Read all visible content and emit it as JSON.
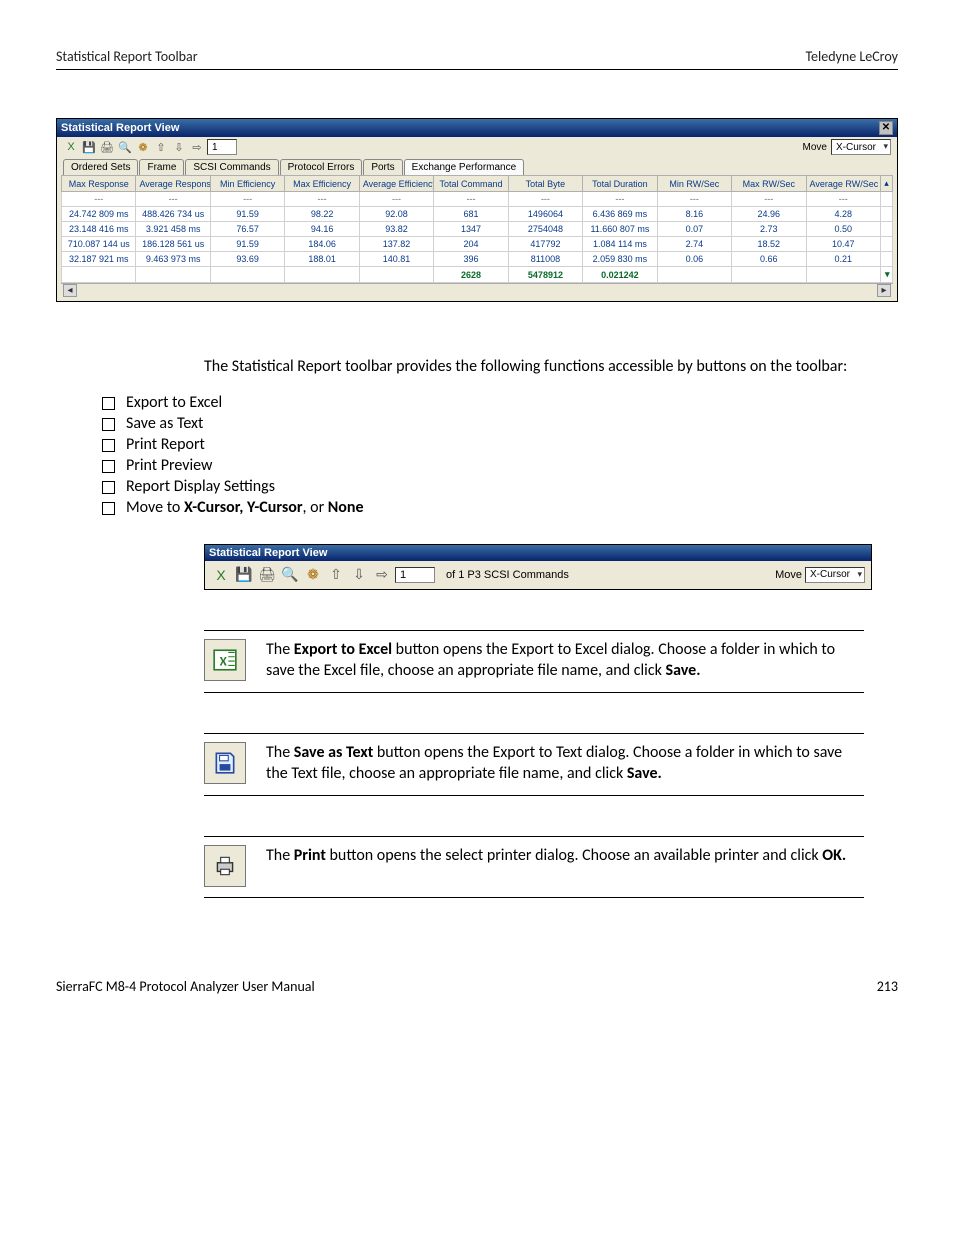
{
  "header": {
    "left": "Statistical Report Toolbar",
    "right": "Teledyne LeCroy"
  },
  "ss1": {
    "title": "Statistical Report View",
    "close": "✕",
    "page_value": "1",
    "move_label": "Move",
    "move_value": "X-Cursor",
    "tabs": [
      "Ordered Sets",
      "Frame",
      "SCSI Commands",
      "Protocol Errors",
      "Ports",
      "Exchange Performance"
    ],
    "active_tab": 5,
    "columns": [
      "Max Response",
      "Average Response",
      "Min Efficiency",
      "Max Efficiency",
      "Average Efficiency",
      "Total Command",
      "Total Byte",
      "Total Duration",
      "Min RW/Sec",
      "Max RW/Sec",
      "Average RW/Sec"
    ],
    "rows": [
      [
        "---",
        "---",
        "---",
        "---",
        "---",
        "---",
        "---",
        "---",
        "---",
        "---",
        "---"
      ],
      [
        "24.742 809  ms",
        "488.426 734  us",
        "91.59",
        "98.22",
        "92.08",
        "681",
        "1496064",
        "6.436 869  ms",
        "8.16",
        "24.96",
        "4.28"
      ],
      [
        "23.148 416  ms",
        "3.921 458  ms",
        "76.57",
        "94.16",
        "93.82",
        "1347",
        "2754048",
        "11.660 807  ms",
        "0.07",
        "2.73",
        "0.50"
      ],
      [
        "710.087 144  us",
        "186.128 561  us",
        "91.59",
        "184.06",
        "137.82",
        "204",
        "417792",
        "1.084 114  ms",
        "2.74",
        "18.52",
        "10.47"
      ],
      [
        "32.187 921  ms",
        "9.463 973  ms",
        "93.69",
        "188.01",
        "140.81",
        "396",
        "811008",
        "2.059 830  ms",
        "0.06",
        "0.66",
        "0.21"
      ]
    ],
    "summary": [
      "",
      "",
      "",
      "",
      "",
      "2628",
      "5478912",
      "0.021242",
      "",
      "",
      ""
    ]
  },
  "intro": "The Statistical Report toolbar provides the following functions accessible by buttons on the toolbar:",
  "checklist": [
    "Export to Excel",
    "Save as Text",
    "Print Report",
    "Print Preview",
    "Report Display Settings"
  ],
  "checklist_move": {
    "prefix": "Move to ",
    "bold": "X-Cursor, Y-Cursor",
    "mid": ", or ",
    "bold2": "None"
  },
  "ss2": {
    "title": "Statistical Report View",
    "page_value": "1",
    "caption": "of 1  P3  SCSI Commands",
    "move_label": "Move",
    "move_value": "X-Cursor"
  },
  "feat1": {
    "pre": "The ",
    "bold": "Export to Excel",
    "post": " button opens the Export to Excel dialog. Choose a folder in which to save the Excel file, choose an appropriate file name, and click ",
    "bold2": "Save."
  },
  "feat2": {
    "pre": "The ",
    "bold": "Save as Text",
    "post": " button opens the Export to Text dialog. Choose a folder in which to save the Text file, choose an appropriate file name, and click ",
    "bold2": "Save."
  },
  "feat3": {
    "pre": "The ",
    "bold": "Print",
    "post": " button opens the select printer dialog. Choose an available printer and click ",
    "bold2": "OK."
  },
  "footer": {
    "left": "SierraFC M8-4 Protocol Analyzer User Manual",
    "right": "213"
  },
  "toolbar_icons": [
    {
      "name": "export-excel-icon",
      "color": "#2a7a2a",
      "glyph": "X"
    },
    {
      "name": "save-text-icon",
      "color": "#2a4aa0",
      "glyph": "💾"
    },
    {
      "name": "print-icon",
      "color": "#555",
      "glyph": "🖨"
    },
    {
      "name": "print-preview-icon",
      "color": "#555",
      "glyph": "🔍"
    },
    {
      "name": "settings-icon",
      "color": "#aa6a00",
      "glyph": "❁"
    },
    {
      "name": "up-arrow-icon",
      "color": "#555",
      "glyph": "⇧"
    },
    {
      "name": "down-arrow-icon",
      "color": "#555",
      "glyph": "⇩"
    },
    {
      "name": "next-arrow-icon",
      "color": "#555",
      "glyph": "⇨"
    }
  ]
}
